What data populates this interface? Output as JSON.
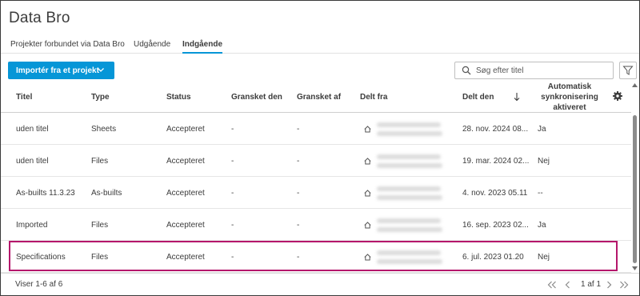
{
  "app": {
    "title": "Data Bro"
  },
  "tabs": [
    {
      "label": "Projekter forbundet via Data Bro",
      "active": false
    },
    {
      "label": "Udgående",
      "active": false
    },
    {
      "label": "Indgående",
      "active": true
    }
  ],
  "toolbar": {
    "import_label": "Importér fra et projekt",
    "search_placeholder": "Søg efter titel"
  },
  "table": {
    "headers": {
      "title": "Titel",
      "type": "Type",
      "status": "Status",
      "reviewed_on": "Gransket den",
      "reviewed_by": "Gransket af",
      "shared_from": "Delt fra",
      "shared_on": "Delt den",
      "auto_sync_line1": "Automatisk",
      "auto_sync_line2": "synkronisering",
      "auto_sync_line3": "aktiveret"
    },
    "rows": [
      {
        "title": "uden titel",
        "type": "Sheets",
        "status": "Accepteret",
        "reviewed_on": "-",
        "reviewed_by": "-",
        "shared_on": "28. nov. 2024 08...",
        "auto_sync": "Ja"
      },
      {
        "title": "uden titel",
        "type": "Files",
        "status": "Accepteret",
        "reviewed_on": "-",
        "reviewed_by": "-",
        "shared_on": "19. mar. 2024 02...",
        "auto_sync": "Nej"
      },
      {
        "title": "As-builts 11.3.23",
        "type": "As-builts",
        "status": "Accepteret",
        "reviewed_on": "-",
        "reviewed_by": "-",
        "shared_on": "4. nov. 2023 05.11",
        "auto_sync": "--"
      },
      {
        "title": "Imported",
        "type": "Files",
        "status": "Accepteret",
        "reviewed_on": "-",
        "reviewed_by": "-",
        "shared_on": "16. sep. 2023 02...",
        "auto_sync": "Ja"
      },
      {
        "title": "Specifications",
        "type": "Files",
        "status": "Accepteret",
        "reviewed_on": "-",
        "reviewed_by": "-",
        "shared_on": "6. jul. 2023 01.20",
        "auto_sync": "Nej"
      }
    ]
  },
  "footer": {
    "showing": "Viser 1-6 af 6",
    "page": "1 af 1"
  },
  "colors": {
    "accent": "#0696d7",
    "highlight": "#b5176b"
  },
  "icons": {
    "import_chevron": "chevron-down-icon",
    "search": "search-icon",
    "filter": "filter-icon",
    "sort": "arrow-down-icon",
    "settings": "gear-icon",
    "shared_from": "home-icon"
  }
}
